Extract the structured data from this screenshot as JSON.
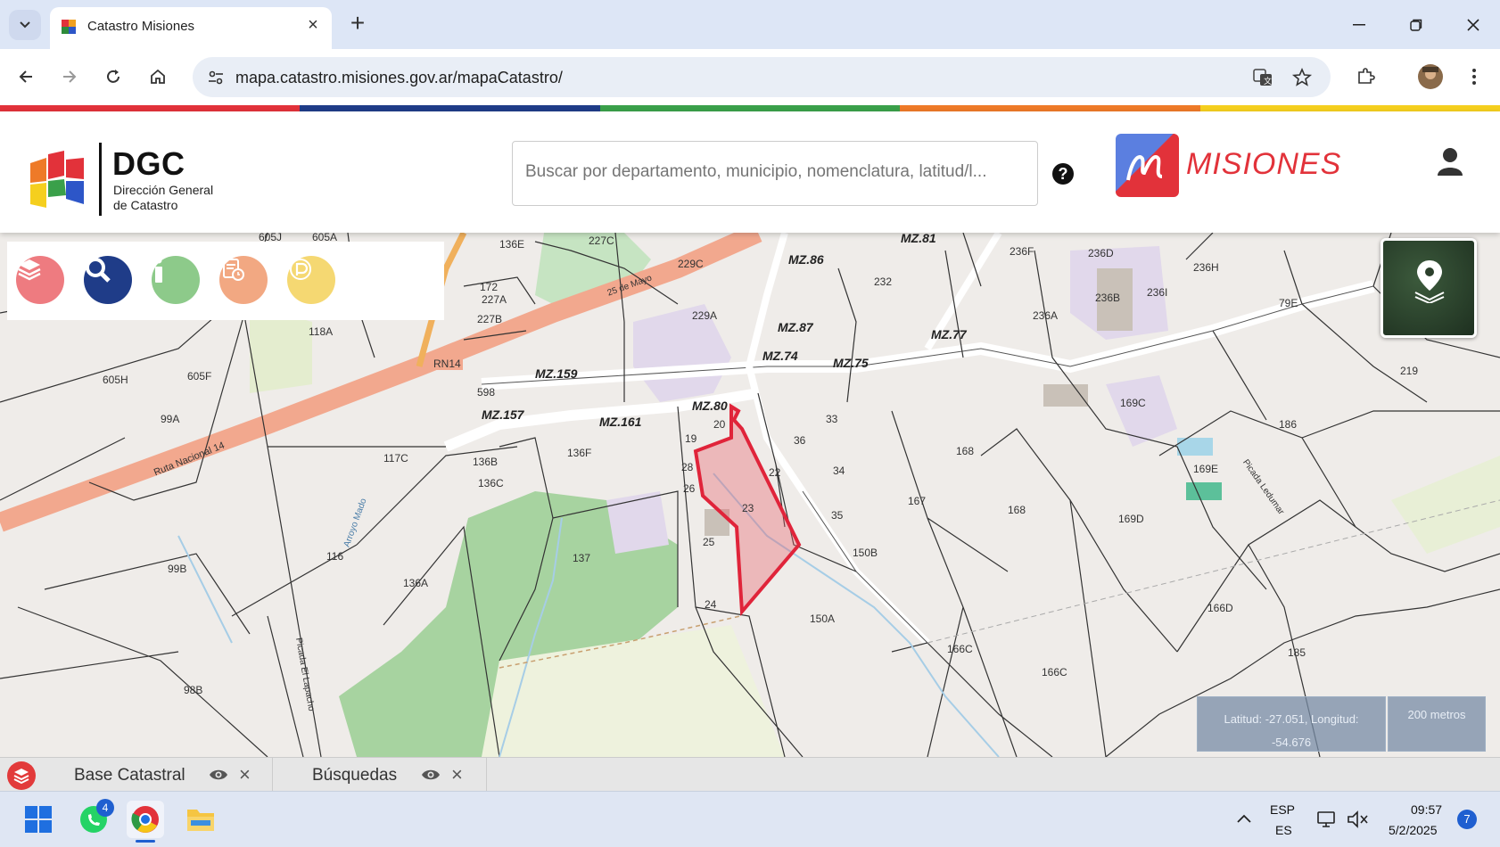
{
  "browser": {
    "tab_title": "Catastro Misiones",
    "url": "mapa.catastro.misiones.gov.ar/mapaCatastro/"
  },
  "header": {
    "logo_title": "DGC",
    "logo_subtitle_1": "Dirección General",
    "logo_subtitle_2": "de Catastro",
    "search_placeholder": "Buscar por departamento, municipio, nomenclatura, latitud/l...",
    "help_label": "?",
    "brand": "MISIONES"
  },
  "map": {
    "coords_label_1": "Latitud: -27.051, Longitud:",
    "coords_label_2": "-54.676",
    "scale_label": "200 metros",
    "labels": {
      "l_605J": "605J",
      "l_605A": "605A",
      "l_136E": "136E",
      "l_227C": "227C",
      "l_MZ81": "MZ.81",
      "l_236F": "236F",
      "l_236D": "236D",
      "l_236H": "236H",
      "l_172": "172",
      "l_229C": "229C",
      "l_MZ86": "MZ.86",
      "l_232": "232",
      "l_236B": "236B",
      "l_236I": "236I",
      "l_79E": "79E",
      "l_227A": "227A",
      "l_227B": "227B",
      "l_229A": "229A",
      "l_236A": "236A",
      "l_118A": "118A",
      "l_MZ87": "MZ.87",
      "l_MZ77": "MZ.77",
      "l_RN14": "RN14",
      "l_MZ74": "MZ.74",
      "l_MZ75": "MZ.75",
      "l_219": "219",
      "l_605H": "605H",
      "l_605F": "605F",
      "l_MZ159": "MZ.159",
      "l_598": "598",
      "l_MZ80": "MZ.80",
      "l_169C": "169C",
      "l_99A": "99A",
      "l_MZ157": "MZ.157",
      "l_MZ161": "MZ.161",
      "l_20": "20",
      "l_33": "33",
      "l_186": "186",
      "l_19": "19",
      "l_36": "36",
      "l_117C": "117C",
      "l_136F": "136F",
      "l_136B": "136B",
      "l_28": "28",
      "l_22": "22",
      "l_34": "34",
      "l_168a": "168",
      "l_169E": "169E",
      "l_136C": "136C",
      "l_26": "26",
      "l_167": "167",
      "l_168b": "168",
      "l_23": "23",
      "l_35": "35",
      "l_169D": "169D",
      "l_25": "25",
      "l_150B": "150B",
      "l_116": "116",
      "l_137": "137",
      "l_99B": "99B",
      "l_136A": "136A",
      "l_24": "24",
      "l_166D": "166D",
      "l_150A": "150A",
      "l_166C1": "166C",
      "l_166C2": "166C",
      "l_185": "185",
      "l_98B": "98B",
      "l_ruta": "Ruta Nacional 14",
      "l_arroyo": "Arroyo Mado",
      "l_picada": "Picada El Lapacho",
      "l_mayo": "25 de Mayo",
      "l_picada2": "Picada Ledumar"
    }
  },
  "layer_tabs": [
    {
      "label": "Base Catastral"
    },
    {
      "label": "Búsquedas"
    }
  ],
  "taskbar": {
    "whatsapp_badge": "4",
    "lang_1": "ESP",
    "lang_2": "ES",
    "time": "09:57",
    "date": "5/2/2025",
    "notifications": "7"
  },
  "colors": {
    "accent_red": "#e2323a",
    "accent_blue": "#1f3c88",
    "parcel_highlight": "#e0243a"
  }
}
